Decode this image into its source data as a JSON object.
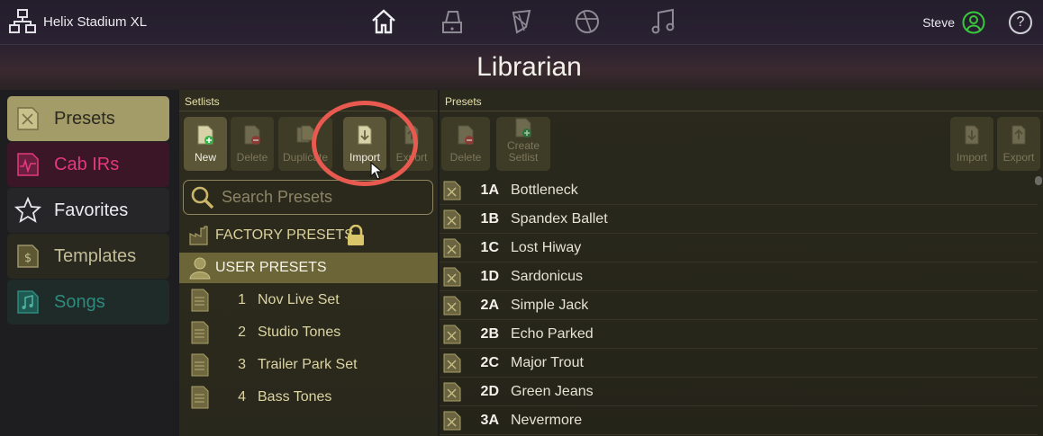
{
  "topbar": {
    "device_name": "Helix Stadium XL",
    "nav_icons": [
      "home-icon",
      "amp-icon",
      "guitar-pick-icon",
      "globe-icon",
      "music-note-icon"
    ],
    "user_name": "Steve",
    "help_label": "?"
  },
  "title": "Librarian",
  "sidebar": {
    "items": [
      {
        "label": "Presets",
        "icon": "preset-icon",
        "selected": true
      },
      {
        "label": "Cab IRs",
        "icon": "cab-ir-icon",
        "color": "#d8367a"
      },
      {
        "label": "Favorites",
        "icon": "star-icon"
      },
      {
        "label": "Templates",
        "icon": "template-icon"
      },
      {
        "label": "Songs",
        "icon": "song-icon",
        "color": "#2f8a7e"
      }
    ]
  },
  "setlists": {
    "header": "Setlists",
    "toolbar": [
      {
        "label": "New",
        "enabled": true
      },
      {
        "label": "Delete",
        "enabled": false
      },
      {
        "label": "Duplicate",
        "enabled": false
      },
      {
        "label": "Import",
        "enabled": true
      },
      {
        "label": "Export",
        "enabled": false
      }
    ],
    "search_placeholder": "Search Presets",
    "factory_label": "FACTORY PRESETS",
    "user_label": "USER PRESETS",
    "items": [
      {
        "num": "1",
        "name": "Nov Live Set"
      },
      {
        "num": "2",
        "name": "Studio Tones"
      },
      {
        "num": "3",
        "name": "Trailer Park Set"
      },
      {
        "num": "4",
        "name": "Bass Tones"
      }
    ]
  },
  "presets": {
    "header": "Presets",
    "toolbar": [
      {
        "label": "Delete",
        "enabled": false
      },
      {
        "label": "Create Setlist",
        "enabled": false
      },
      {
        "label": "Import",
        "enabled": false
      },
      {
        "label": "Export",
        "enabled": false
      }
    ],
    "items": [
      {
        "slot": "1A",
        "name": "Bottleneck"
      },
      {
        "slot": "1B",
        "name": "Spandex Ballet"
      },
      {
        "slot": "1C",
        "name": "Lost Hiway"
      },
      {
        "slot": "1D",
        "name": "Sardonicus"
      },
      {
        "slot": "2A",
        "name": "Simple Jack"
      },
      {
        "slot": "2B",
        "name": "Echo Parked"
      },
      {
        "slot": "2C",
        "name": "Major Trout"
      },
      {
        "slot": "2D",
        "name": "Green Jeans"
      },
      {
        "slot": "3A",
        "name": "Nevermore"
      }
    ]
  },
  "colors": {
    "accent": "#e85a4f",
    "panel_gold": "#e8e0a8",
    "user_online": "#39c93c"
  }
}
